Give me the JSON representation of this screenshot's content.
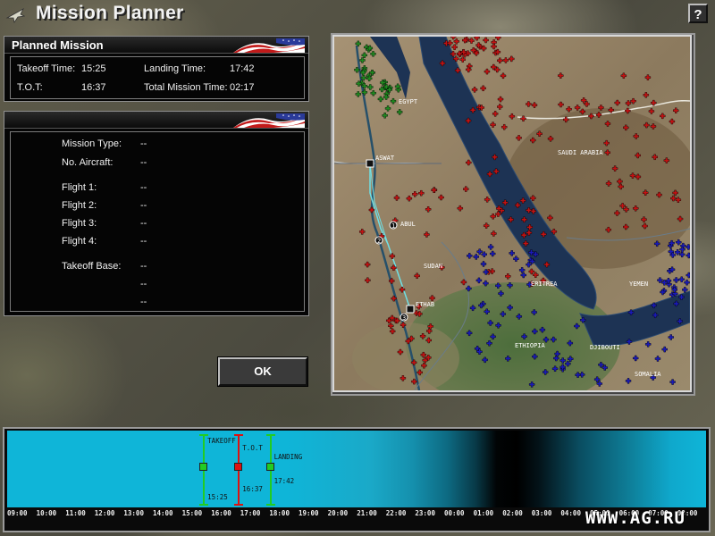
{
  "window": {
    "title": "Mission Planner",
    "help_label": "?"
  },
  "planned_mission": {
    "header": "Planned Mission",
    "takeoff_label": "Takeoff Time:",
    "takeoff_value": "15:25",
    "landing_label": "Landing Time:",
    "landing_value": "17:42",
    "tot_label": "T.O.T:",
    "tot_value": "16:37",
    "total_label": "Total Mission Time:",
    "total_value": "02:17"
  },
  "details": {
    "mission_type_label": "Mission Type:",
    "mission_type_value": "--",
    "aircraft_label": "No. Aircraft:",
    "aircraft_value": "--",
    "flight1_label": "Flight 1:",
    "flight1_value": "--",
    "flight2_label": "Flight 2:",
    "flight2_value": "--",
    "flight3_label": "Flight 3:",
    "flight3_value": "--",
    "flight4_label": "Flight 4:",
    "flight4_value": "--",
    "base_label": "Takeoff Base:",
    "base_value": "--",
    "extra1_value": "--",
    "extra2_value": "--"
  },
  "ok_button": {
    "label": "OK"
  },
  "map": {
    "labels": {
      "egypt": "EGYPT",
      "saudi": "SAUDI ARABIA",
      "sudan": "SUDAN",
      "eritrea": "ERITREA",
      "yemen": "YEMEN",
      "ethiopia": "ETHIOPIA",
      "djibouti": "DJIBOUTI",
      "somalia": "SOMALIA",
      "wp1": "ABUL",
      "wp_start": "ASWAT",
      "wp_end": "ETHAB",
      "wp_num1": "1",
      "wp_num2": "2",
      "wp_num3": "3"
    },
    "colors": {
      "hostile": "#c41212",
      "friendly": "#1a1ab8",
      "neutral": "#1f8a1f",
      "route": "#6fe0e6"
    }
  },
  "timeline": {
    "ticks": [
      "09:00",
      "10:00",
      "11:00",
      "12:00",
      "13:00",
      "14:00",
      "15:00",
      "16:00",
      "17:00",
      "18:00",
      "19:00",
      "20:00",
      "21:00",
      "22:00",
      "23:00",
      "00:00",
      "01:00",
      "02:00",
      "03:00",
      "04:00",
      "05:00",
      "06:00",
      "07:00",
      "08:00"
    ],
    "takeoff": {
      "label": "TAKEOFF",
      "time": "15:25",
      "color": "#22cc22"
    },
    "tot": {
      "label": "T.O.T",
      "time": "16:37",
      "color": "#dd1111"
    },
    "landing": {
      "label": "LANDING",
      "time": "17:42",
      "color": "#22cc22"
    }
  },
  "watermark": "WWW.AG.RU"
}
